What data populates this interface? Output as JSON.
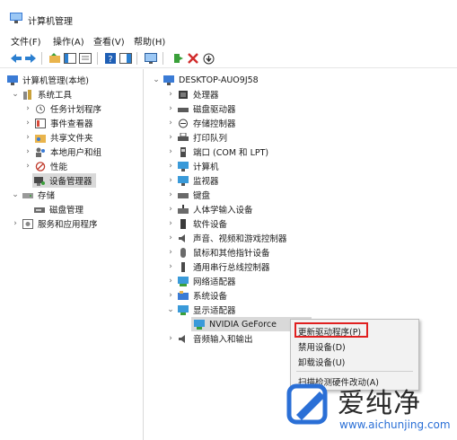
{
  "window": {
    "title": "计算机管理"
  },
  "menu": [
    "文件(F)",
    "操作(A)",
    "查看(V)",
    "帮助(H)"
  ],
  "left_tree": {
    "root": "计算机管理(本地)",
    "system_tools": "系统工具",
    "task_scheduler": "任务计划程序",
    "event_viewer": "事件查看器",
    "shared_folders": "共享文件夹",
    "local_users": "本地用户和组",
    "performance": "性能",
    "device_manager": "设备管理器",
    "storage": "存储",
    "disk_management": "磁盘管理",
    "services": "服务和应用程序"
  },
  "right_tree": {
    "computer": "DESKTOP-AUO9J58",
    "categories": [
      "处理器",
      "磁盘驱动器",
      "存储控制器",
      "打印队列",
      "端口 (COM 和 LPT)",
      "计算机",
      "监视器",
      "键盘",
      "人体学输入设备",
      "软件设备",
      "声音、视频和游戏控制器",
      "鼠标和其他指针设备",
      "通用串行总线控制器",
      "网络适配器",
      "系统设备",
      "显示适配器",
      "NVIDIA GeForce",
      "音频输入和输出"
    ]
  },
  "context_menu": {
    "update_driver": "更新驱动程序(P)",
    "disable_device": "禁用设备(D)",
    "uninstall_device": "卸载设备(U)",
    "scan_hardware": "扫描检测硬件改动(A)"
  },
  "watermark": {
    "text": "爱纯净",
    "url": "www.aichunjing.com"
  },
  "colors": {
    "highlight": "#e02020",
    "selection": "#d9d9d9",
    "accent": "#2a6fd6"
  }
}
